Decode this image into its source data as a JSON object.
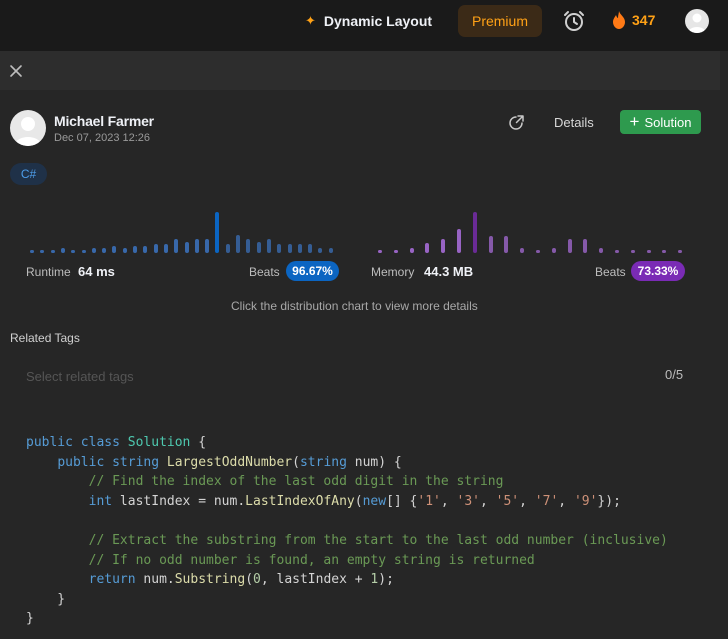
{
  "topbar": {
    "dynamic_layout": "Dynamic Layout",
    "premium": "Premium",
    "streak": "347",
    "colors": {
      "accent": "#ffa116"
    }
  },
  "user": {
    "name": "Michael Farmer",
    "date": "Dec 07, 2023 12:26"
  },
  "actions": {
    "details": "Details",
    "solution": "Solution"
  },
  "language_tag": "C#",
  "runtime": {
    "label": "Runtime",
    "value": "64 ms",
    "beats_label": "Beats",
    "beats": "96.67%",
    "color": "#0b65c2"
  },
  "memory": {
    "label": "Memory",
    "value": "44.3 MB",
    "beats_label": "Beats",
    "beats": "73.33%",
    "color": "#7a2bb5"
  },
  "hint": "Click the distribution chart to view more details",
  "related_tags": {
    "title": "Related Tags",
    "placeholder": "Select related tags",
    "count": "0/5"
  },
  "code": [
    [
      {
        "c": "k",
        "t": "public"
      },
      {
        "c": "p",
        "t": " "
      },
      {
        "c": "k",
        "t": "class"
      },
      {
        "c": "p",
        "t": " "
      },
      {
        "c": "t",
        "t": "Solution"
      },
      {
        "c": "p",
        "t": " {"
      }
    ],
    [
      {
        "c": "p",
        "t": "    "
      },
      {
        "c": "k",
        "t": "public"
      },
      {
        "c": "p",
        "t": " "
      },
      {
        "c": "k",
        "t": "string"
      },
      {
        "c": "p",
        "t": " "
      },
      {
        "c": "f",
        "t": "LargestOddNumber"
      },
      {
        "c": "p",
        "t": "("
      },
      {
        "c": "k",
        "t": "string"
      },
      {
        "c": "p",
        "t": " num) {"
      }
    ],
    [
      {
        "c": "p",
        "t": "        "
      },
      {
        "c": "c",
        "t": "// Find the index of the last odd digit in the string"
      }
    ],
    [
      {
        "c": "p",
        "t": "        "
      },
      {
        "c": "k",
        "t": "int"
      },
      {
        "c": "p",
        "t": " lastIndex = num."
      },
      {
        "c": "f",
        "t": "LastIndexOfAny"
      },
      {
        "c": "p",
        "t": "("
      },
      {
        "c": "k",
        "t": "new"
      },
      {
        "c": "p",
        "t": "[] {"
      },
      {
        "c": "s",
        "t": "'1'"
      },
      {
        "c": "p",
        "t": ", "
      },
      {
        "c": "s",
        "t": "'3'"
      },
      {
        "c": "p",
        "t": ", "
      },
      {
        "c": "s",
        "t": "'5'"
      },
      {
        "c": "p",
        "t": ", "
      },
      {
        "c": "s",
        "t": "'7'"
      },
      {
        "c": "p",
        "t": ", "
      },
      {
        "c": "s",
        "t": "'9'"
      },
      {
        "c": "p",
        "t": "});"
      }
    ],
    [],
    [
      {
        "c": "p",
        "t": "        "
      },
      {
        "c": "c",
        "t": "// Extract the substring from the start to the last odd number (inclusive)"
      }
    ],
    [
      {
        "c": "p",
        "t": "        "
      },
      {
        "c": "c",
        "t": "// If no odd number is found, an empty string is returned"
      }
    ],
    [
      {
        "c": "p",
        "t": "        "
      },
      {
        "c": "k",
        "t": "return"
      },
      {
        "c": "p",
        "t": " num."
      },
      {
        "c": "f",
        "t": "Substring"
      },
      {
        "c": "p",
        "t": "("
      },
      {
        "c": "n",
        "t": "0"
      },
      {
        "c": "p",
        "t": ", lastIndex + "
      },
      {
        "c": "n",
        "t": "1"
      },
      {
        "c": "p",
        "t": ");"
      }
    ],
    [
      {
        "c": "p",
        "t": "    }"
      }
    ],
    [
      {
        "c": "p",
        "t": "}"
      }
    ]
  ],
  "chart_data": [
    {
      "type": "bar",
      "values": [
        1,
        1,
        1,
        2,
        1,
        1,
        2,
        2,
        3,
        2,
        3,
        3,
        4,
        4,
        6,
        5,
        6,
        6,
        18,
        4,
        8,
        6,
        5,
        6,
        4,
        4,
        4,
        4,
        2,
        2
      ],
      "highlight_index": 18,
      "colors": {
        "bar": "#4a6a88",
        "highlight": "#3b70b9",
        "current": "#0b65c2"
      }
    },
    {
      "type": "bar",
      "values": [
        1,
        1,
        2,
        4,
        6,
        10,
        17,
        7,
        7,
        2,
        1,
        2,
        6,
        6,
        2,
        1,
        1,
        1,
        1,
        1
      ],
      "highlight_index": 6,
      "colors": {
        "bar": "#8b6a9e",
        "highlight": "#a56bd6",
        "current": "#6a2b96"
      }
    }
  ]
}
